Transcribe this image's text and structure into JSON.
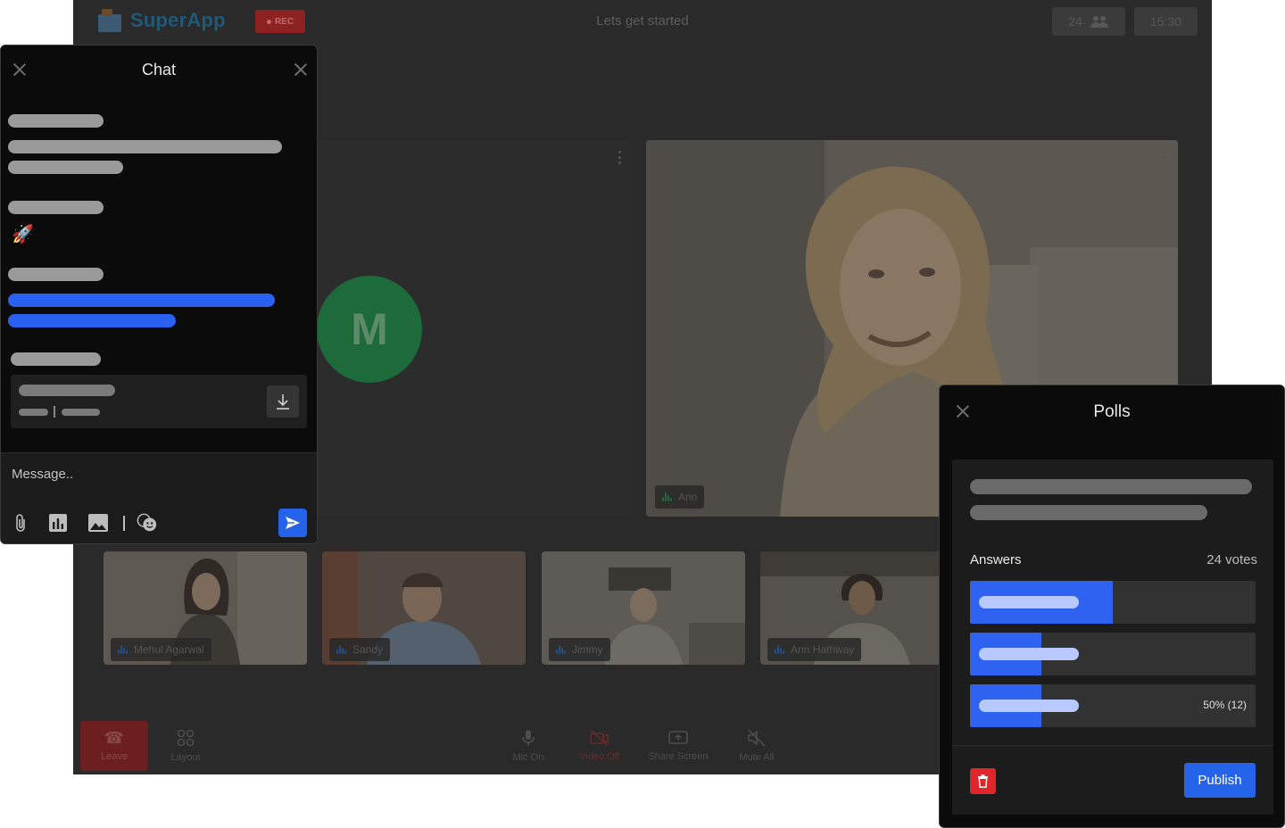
{
  "app": {
    "brand": "SuperApp",
    "rec_label": "REC",
    "meeting_title": "Lets get started",
    "participant_count": "24",
    "time": "15:30",
    "main_tiles": [
      {
        "initial": "M"
      },
      {
        "name": "Ann"
      }
    ],
    "thumbnails": [
      {
        "name": "Mehul Agarwal"
      },
      {
        "name": "Sandy"
      },
      {
        "name": "Jimmy"
      },
      {
        "name": "Ann Hathway"
      }
    ],
    "toolbar": {
      "leave": "Leave",
      "layout": "Layout",
      "mic": "Mic On",
      "video": "Video Off",
      "share": "Share Screen",
      "mute_all": "Mute All"
    },
    "colors": {
      "accent": "#2563eb",
      "record": "#8e2222",
      "avatar": "#1d6a3b",
      "danger": "#e0262a"
    }
  },
  "chat": {
    "title": "Chat",
    "emoji": "🚀",
    "input_placeholder": "Message..",
    "icons": [
      "close-icon",
      "attachment-icon",
      "poll-chart-icon",
      "image-icon",
      "emoji-icon",
      "send-icon",
      "download-icon"
    ]
  },
  "polls": {
    "title": "Polls",
    "answers_label": "Answers",
    "votes_label": "24 votes",
    "answers": [
      {
        "fill_percent": 50
      },
      {
        "fill_percent": 25
      },
      {
        "fill_percent": 25,
        "result": "50% (12)"
      }
    ],
    "publish_label": "Publish"
  }
}
